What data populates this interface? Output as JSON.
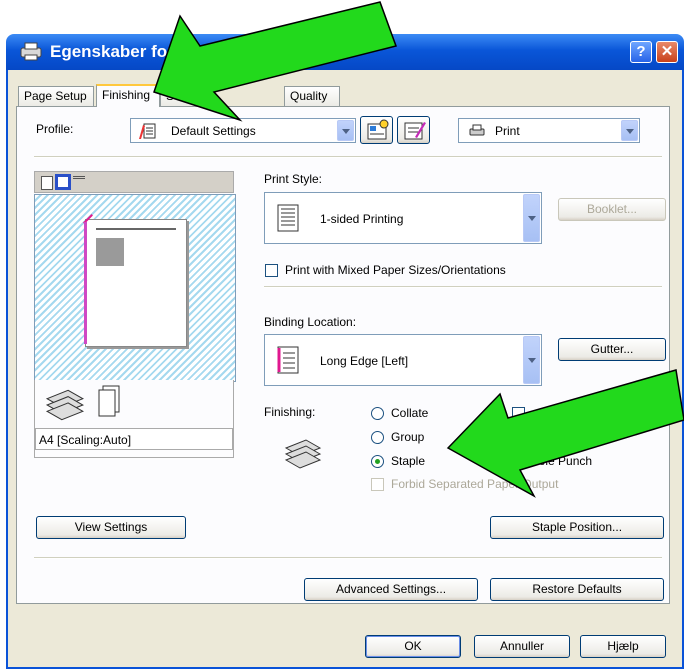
{
  "window": {
    "title": "Egenskaber for C"
  },
  "tabs": [
    {
      "label": "Page Setup"
    },
    {
      "label": "Finishing"
    },
    {
      "label": "Source"
    },
    {
      "label": "Quality"
    }
  ],
  "profile": {
    "label": "Profile:",
    "value": "Default Settings",
    "output_value": "Print"
  },
  "preview": {
    "paper_label": "A4 [Scaling:Auto]"
  },
  "print_style": {
    "label": "Print Style:",
    "value": "1-sided Printing",
    "booklet_button": "Booklet...",
    "mixed_paper_label": "Print with Mixed Paper Sizes/Orientations"
  },
  "binding": {
    "label": "Binding Location:",
    "value": "Long Edge [Left]",
    "gutter_button": "Gutter..."
  },
  "finishing": {
    "label": "Finishing:",
    "options": [
      "Collate",
      "Group",
      "Staple"
    ],
    "selected": "Staple",
    "hole_punch_label": "Hole Punch",
    "forbid_label": "Forbid Separated Paper Output"
  },
  "buttons": {
    "view_settings": "View Settings",
    "staple_position": "Staple Position...",
    "advanced_settings": "Advanced Settings...",
    "restore_defaults": "Restore Defaults",
    "ok": "OK",
    "cancel": "Annuller",
    "help": "Hjælp"
  },
  "colors": {
    "titlebar": "#0a56d8",
    "dialog_bg": "#ece9d8",
    "arrow_green": "#22d91c",
    "selected_radio": "#21a121"
  }
}
